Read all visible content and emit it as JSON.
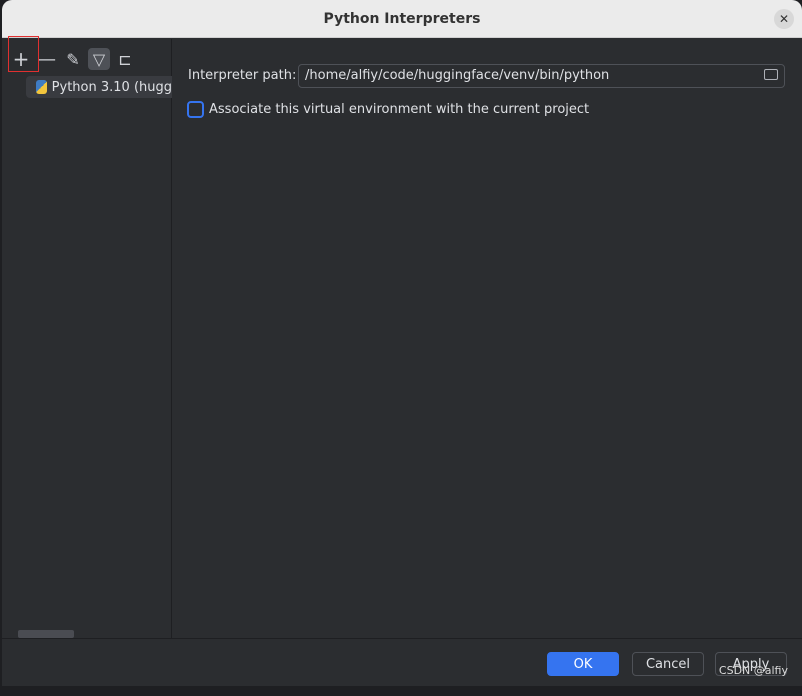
{
  "dialog": {
    "title": "Python Interpreters"
  },
  "toolbar": {
    "icons": [
      "plus-icon",
      "minus-icon",
      "pencil-icon",
      "filter-icon",
      "tree-icon"
    ]
  },
  "sidebar": {
    "items": [
      {
        "label": "Python 3.10 (hugg"
      }
    ]
  },
  "main": {
    "interpreter_label": "Interpreter path:",
    "interpreter_path": "/home/alfiy/code/huggingface/venv/bin/python",
    "associate_label": "Associate this virtual environment with the current project",
    "associate_checked": false
  },
  "footer": {
    "ok": "OK",
    "cancel": "Cancel",
    "apply": "Apply"
  },
  "watermark": "CSDN @alfiy",
  "colors": {
    "accent": "#3574f0",
    "highlight": "#e03030"
  }
}
